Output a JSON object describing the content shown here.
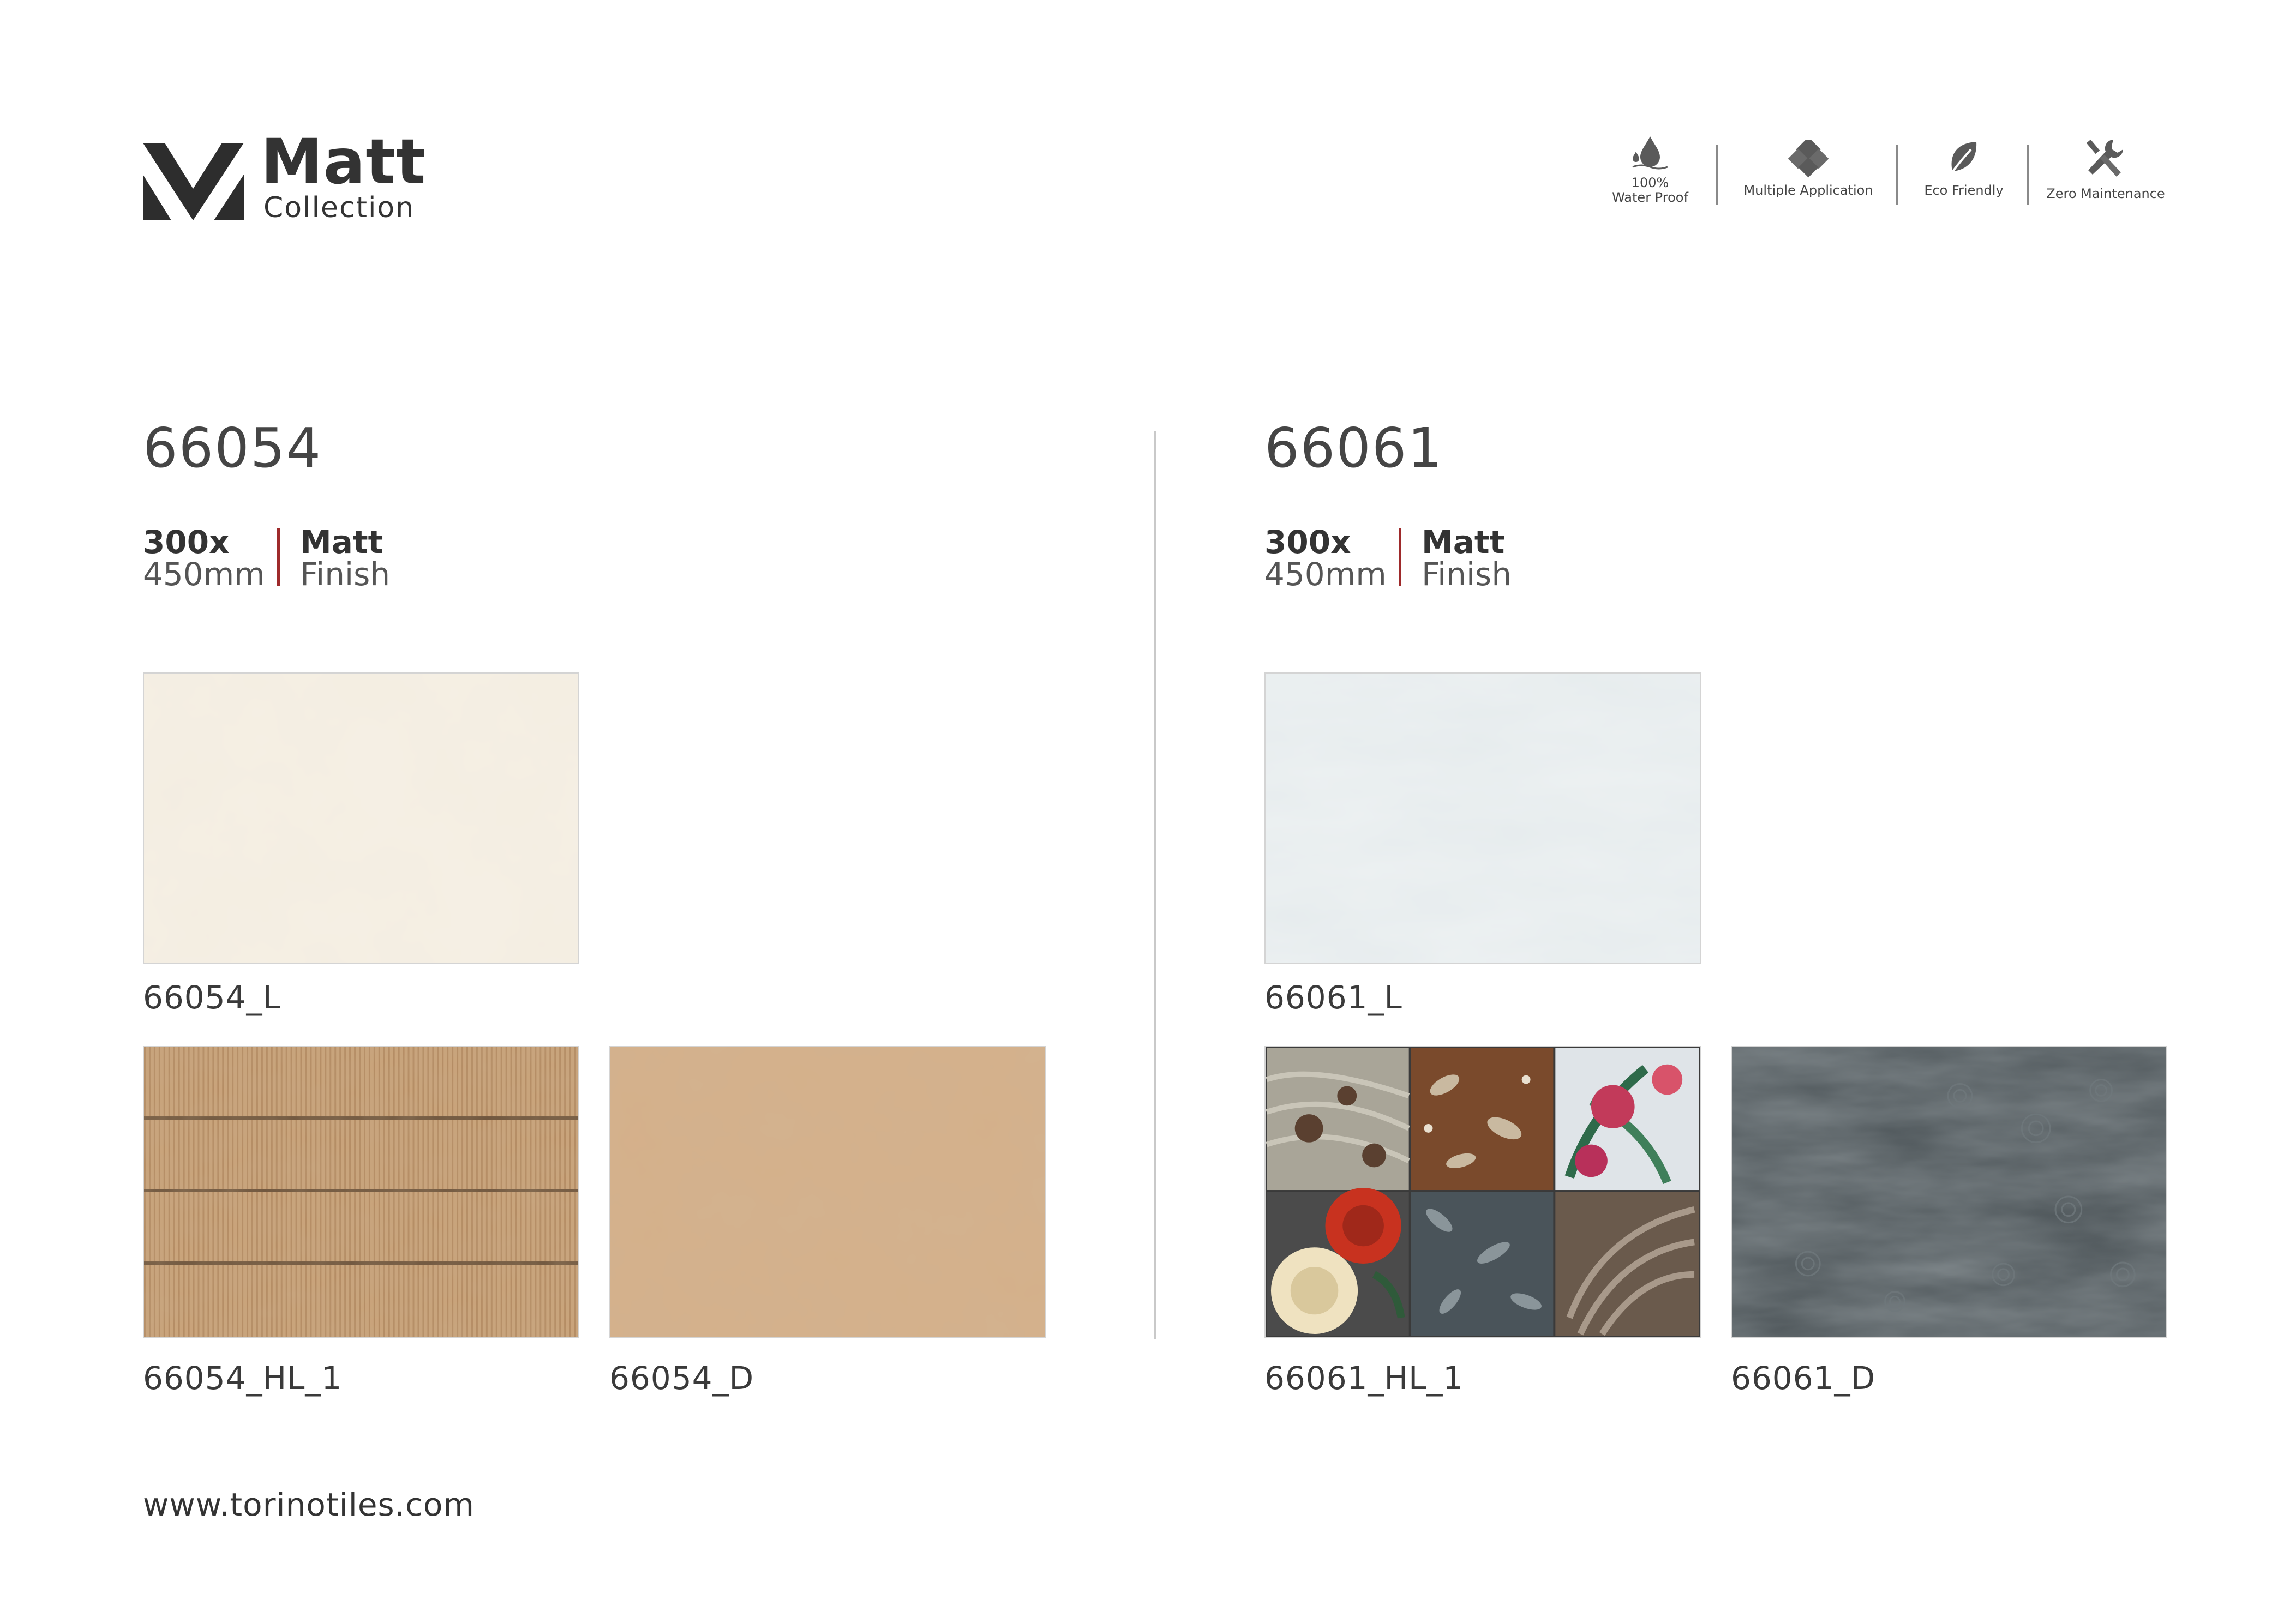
{
  "brand": {
    "title": "Matt",
    "subtitle": "Collection"
  },
  "features": [
    {
      "icon": "water-drop-icon",
      "line1": "100%",
      "line2": "Water Proof"
    },
    {
      "icon": "multiple-application-icon",
      "line1": "",
      "line2": "Multiple Application"
    },
    {
      "icon": "leaf-icon",
      "line1": "",
      "line2": "Eco Friendly"
    },
    {
      "icon": "wrench-screwdriver-icon",
      "line1": "",
      "line2": "Zero Maintenance"
    }
  ],
  "products": [
    {
      "code": "66054",
      "size_line1": "300x",
      "size_line2": "450mm",
      "finish_line1": "Matt",
      "finish_line2": "Finish",
      "tiles": [
        {
          "label": "66054_L",
          "style": "cream-light"
        },
        {
          "label": "66054_HL_1",
          "style": "beige-ribbed"
        },
        {
          "label": "66054_D",
          "style": "beige-mottled"
        }
      ]
    },
    {
      "code": "66061",
      "size_line1": "300x",
      "size_line2": "450mm",
      "finish_line1": "Matt",
      "finish_line2": "Finish",
      "tiles": [
        {
          "label": "66061_L",
          "style": "pale-blue-grey"
        },
        {
          "label": "66061_HL_1",
          "style": "floral-patchwork"
        },
        {
          "label": "66061_D",
          "style": "dark-grey-swirl"
        }
      ]
    }
  ],
  "colors": {
    "text": "#333333",
    "accent_divider": "#9e2a2b",
    "column_divider": "#c9c9c9"
  },
  "footer": {
    "website": "www.torinotiles.com"
  }
}
